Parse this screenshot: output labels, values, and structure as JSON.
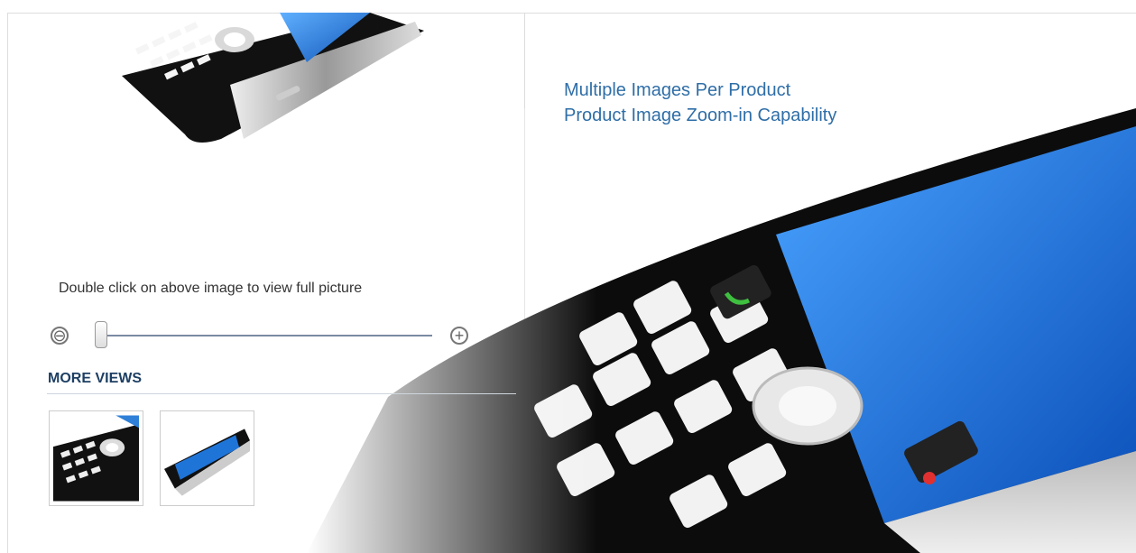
{
  "features": [
    "Multiple Images Per Product",
    "Product Image Zoom-in Capability"
  ],
  "zoom": {
    "hint": "Double click on above image to view full picture",
    "zoom_out_symbol": "⊖",
    "zoom_in_symbol": "+",
    "level": 0
  },
  "more_views": {
    "title": "MORE VIEWS"
  },
  "colors": {
    "feature_text": "#2f6ea7",
    "heading": "#1d3f63",
    "phone_screen": "#1f74d8"
  }
}
